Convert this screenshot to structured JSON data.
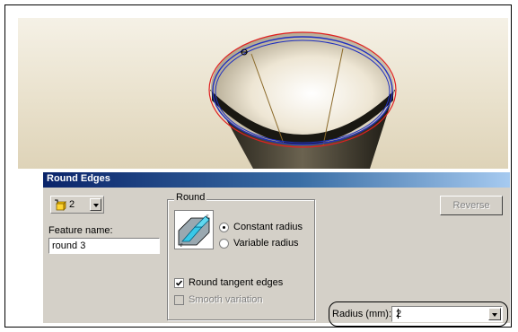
{
  "dialog": {
    "title": "Round Edges",
    "edge_count": "2",
    "feature_name_label": "Feature name:",
    "feature_name_value": "round 3",
    "round_group_title": "Round",
    "constant_radius_label": "Constant radius",
    "variable_radius_label": "Variable radius",
    "radius_mode_selected": "constant",
    "round_tangent_edges_label": "Round tangent edges",
    "round_tangent_edges_checked": true,
    "smooth_variation_label": "Smooth variation",
    "smooth_variation_checked": false,
    "reverse_label": "Reverse",
    "radius_label": "Radius (mm):",
    "radius_value": "2"
  },
  "icons": {
    "edge_select": "cube-edge-icon",
    "round_preview": "round-edge-preview-icon"
  },
  "colors": {
    "title_start": "#0a246a",
    "title_end": "#a6caf0",
    "dialog_bg": "#d4d0c8",
    "edge_highlight_red": "#e02020",
    "edge_highlight_blue": "#2030c0"
  }
}
